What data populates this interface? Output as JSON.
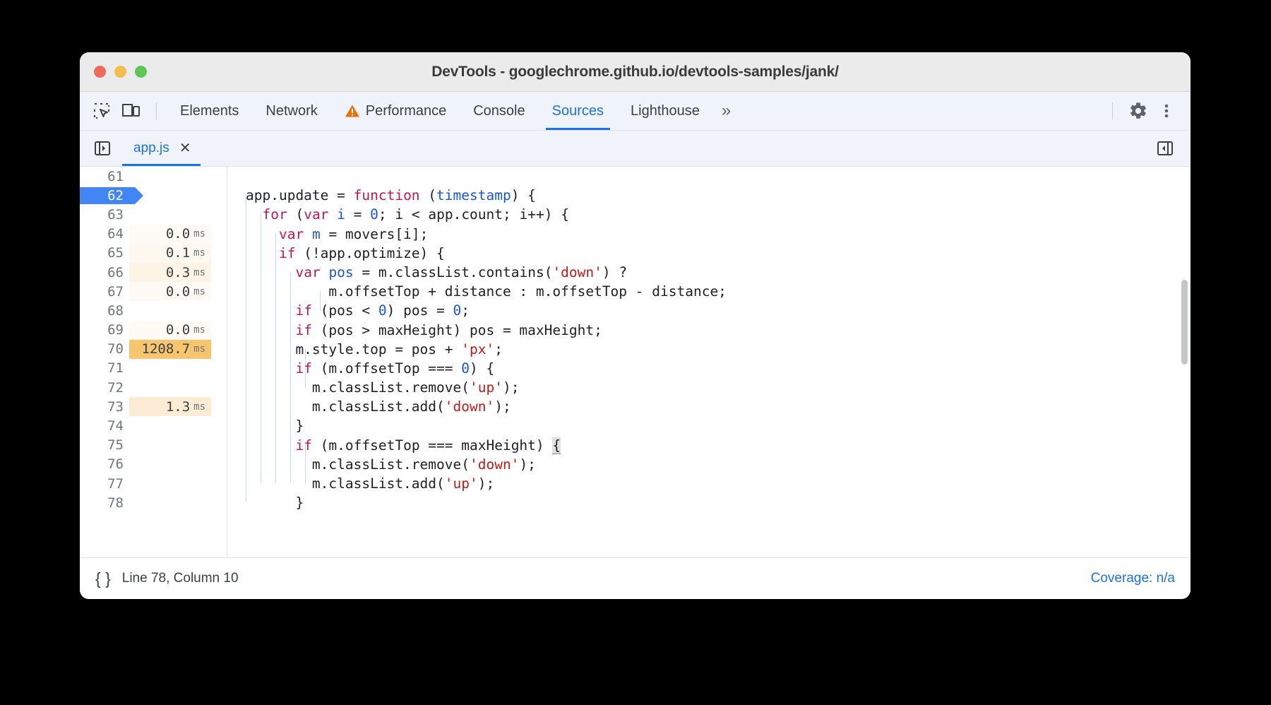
{
  "window": {
    "title": "DevTools - googlechrome.github.io/devtools-samples/jank/",
    "traffic_lights": {
      "close": "close-window",
      "minimize": "minimize-window",
      "maximize": "maximize-window"
    }
  },
  "toolbar": {
    "inspect_icon": "inspect-element-icon",
    "device_icon": "device-toolbar-icon",
    "settings_icon": "gear-icon",
    "more_icon": "more-options-icon",
    "tabs": [
      {
        "label": "Elements",
        "active": false,
        "warning": false
      },
      {
        "label": "Network",
        "active": false,
        "warning": false
      },
      {
        "label": "Performance",
        "active": false,
        "warning": true
      },
      {
        "label": "Console",
        "active": false,
        "warning": false
      },
      {
        "label": "Sources",
        "active": true,
        "warning": false
      },
      {
        "label": "Lighthouse",
        "active": false,
        "warning": false
      }
    ],
    "more_tabs_label": "»"
  },
  "filebar": {
    "navigator_icon": "show-navigator-icon",
    "sidebar_icon": "show-debugger-sidebar-icon",
    "tab_label": "app.js",
    "close_label": "✕"
  },
  "editor": {
    "unit_label": "ms",
    "current_line": 62,
    "lines": [
      {
        "num": "61",
        "timing": "",
        "code": ""
      },
      {
        "num": "62",
        "timing": "",
        "code": "app.update = function (timestamp) {"
      },
      {
        "num": "63",
        "timing": "",
        "code": "  for (var i = 0; i < app.count; i++) {"
      },
      {
        "num": "64",
        "timing": "0.0",
        "code": "    var m = movers[i];"
      },
      {
        "num": "65",
        "timing": "0.1",
        "code": "    if (!app.optimize) {"
      },
      {
        "num": "66",
        "timing": "0.3",
        "code": "      var pos = m.classList.contains('down') ?"
      },
      {
        "num": "67",
        "timing": "0.0",
        "code": "          m.offsetTop + distance : m.offsetTop - distance;"
      },
      {
        "num": "68",
        "timing": "",
        "code": "      if (pos < 0) pos = 0;"
      },
      {
        "num": "69",
        "timing": "0.0",
        "code": "      if (pos > maxHeight) pos = maxHeight;"
      },
      {
        "num": "70",
        "timing": "1208.7",
        "code": "      m.style.top = pos + 'px';"
      },
      {
        "num": "71",
        "timing": "",
        "code": "      if (m.offsetTop === 0) {"
      },
      {
        "num": "72",
        "timing": "",
        "code": "        m.classList.remove('up');"
      },
      {
        "num": "73",
        "timing": "1.3",
        "code": "        m.classList.add('down');"
      },
      {
        "num": "74",
        "timing": "",
        "code": "      }"
      },
      {
        "num": "75",
        "timing": "",
        "code": "      if (m.offsetTop === maxHeight) {"
      },
      {
        "num": "76",
        "timing": "",
        "code": "        m.classList.remove('down');"
      },
      {
        "num": "77",
        "timing": "",
        "code": "        m.classList.add('up');"
      },
      {
        "num": "78",
        "timing": "",
        "code": "      }"
      }
    ]
  },
  "statusbar": {
    "pretty_print_icon": "{ }",
    "cursor_position": "Line 78, Column 10",
    "coverage": "Coverage: n/a"
  },
  "colors": {
    "accent": "#1a73e8",
    "exec_highlight": "#4285f4",
    "timing_hot": "#f7c56d",
    "warning": "#e8710a",
    "keyword": "#c5174e",
    "string": "#c41a16",
    "number": "#1a56d6"
  }
}
